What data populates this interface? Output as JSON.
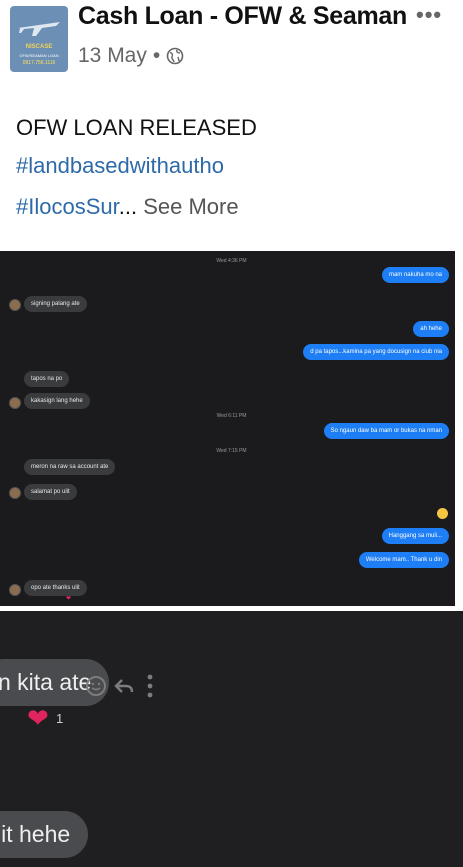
{
  "post": {
    "page_name": "Cash Loan - OFW & Seaman",
    "date": "13 May",
    "separator": "•",
    "more_label": "•••",
    "line1": "OFW LOAN RELEASED",
    "hashtag1": "#landbasedwithautho",
    "hashtag2": "#IlocosSur",
    "ellipsis": "...",
    "see_more": "See More",
    "avatar": {
      "brand": "NISCASE",
      "sub": "OFW/SEAMAN LOAN",
      "phone": "0917.756.1116"
    }
  },
  "chat1": {
    "timestamps": [
      "Wed 4:36 PM",
      "Wed 6:11 PM",
      "Wed 7:15 PM"
    ],
    "messages": [
      {
        "side": "right",
        "text": "mam nakuha mo na"
      },
      {
        "side": "left",
        "text": "signing palang ate"
      },
      {
        "side": "right",
        "text": "ah hehe"
      },
      {
        "side": "right",
        "text": "d pa tapos...kamina pa yang docusign na ciub nia"
      },
      {
        "side": "left",
        "text": "tapos na po"
      },
      {
        "side": "left",
        "text": "kakasign lang hehe"
      },
      {
        "side": "right",
        "text": "So ngaun daw ba mam or bukas na nman"
      },
      {
        "side": "left",
        "text": "meron na raw sa account ate"
      },
      {
        "side": "left",
        "text": "salamat po ulit"
      },
      {
        "side": "right",
        "text": "Hanggang sa muli..."
      },
      {
        "side": "right",
        "text": "Welcome mam.. Thank u din"
      },
      {
        "side": "left",
        "text": "opo ate thanks ulit"
      }
    ]
  },
  "chat2": {
    "bubble1": "n kita ate",
    "reaction_count": "1",
    "bubble2": "lit hehe",
    "heart": "❤"
  },
  "colors": {
    "hashtag": "#2e6aa8",
    "messenger_blue": "#1e7ef5",
    "chat_bg": "#1b1b1d"
  }
}
